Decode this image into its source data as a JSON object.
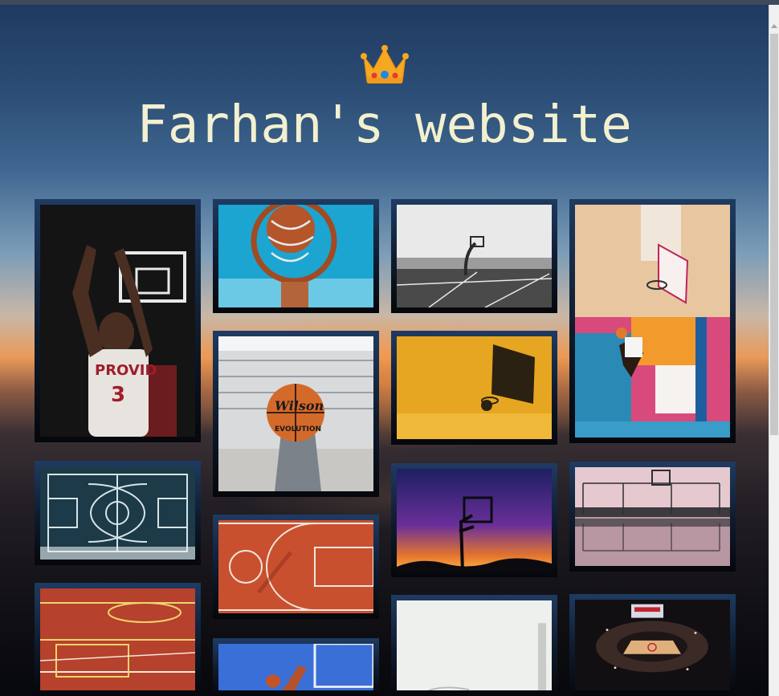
{
  "site": {
    "title": "Farhan's website",
    "logo_icon": "crown-icon"
  },
  "colors": {
    "title_text": "#f3f0cf",
    "tile_frame_top": "#1e3b62",
    "tile_frame_bottom": "#05070b"
  },
  "gallery": {
    "photos": [
      {
        "subject": "basketball-player-shooting",
        "jersey_text": "PROVID",
        "jersey_number": "3"
      },
      {
        "subject": "hoop-from-below-blue-sky"
      },
      {
        "subject": "seaside-court-black-and-white"
      },
      {
        "subject": "player-dunking-colorful-court"
      },
      {
        "subject": "court-aerial-dark-teal"
      },
      {
        "subject": "hand-holding-wilson-ball",
        "ball_brand": "Wilson",
        "ball_model": "EVOLUTION"
      },
      {
        "subject": "hoop-silhouette-golden-sky"
      },
      {
        "subject": "orange-court-aerial"
      },
      {
        "subject": "hoop-silhouette-purple-sunset"
      },
      {
        "subject": "hoop-reflection-pink-sky"
      },
      {
        "subject": "red-court-yellow-lines"
      },
      {
        "subject": "player-shooting-blue-sky"
      },
      {
        "subject": "pale-sky-hoop"
      },
      {
        "subject": "arena-aerial-night"
      }
    ]
  }
}
